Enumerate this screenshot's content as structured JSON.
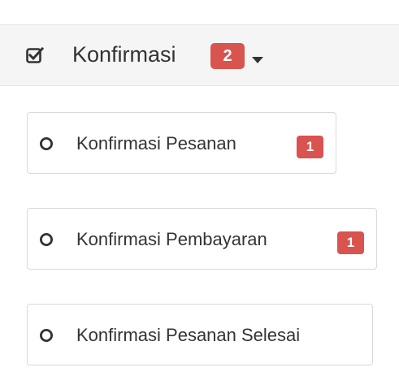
{
  "menu": {
    "label": "Konfirmasi",
    "badge": "2",
    "icon": "check-square-icon",
    "items": [
      {
        "label": "Konfirmasi Pesanan",
        "badge": "1",
        "icon": "circle-outline-icon"
      },
      {
        "label": "Konfirmasi Pembayaran",
        "badge": "1",
        "icon": "circle-outline-icon"
      },
      {
        "label": "Konfirmasi Pesanan Selesai",
        "icon": "circle-outline-icon"
      }
    ]
  },
  "colors": {
    "badge": "#d9534f",
    "header_bg": "#f5f5f5",
    "text": "#333333",
    "border": "#d9d9d9"
  }
}
